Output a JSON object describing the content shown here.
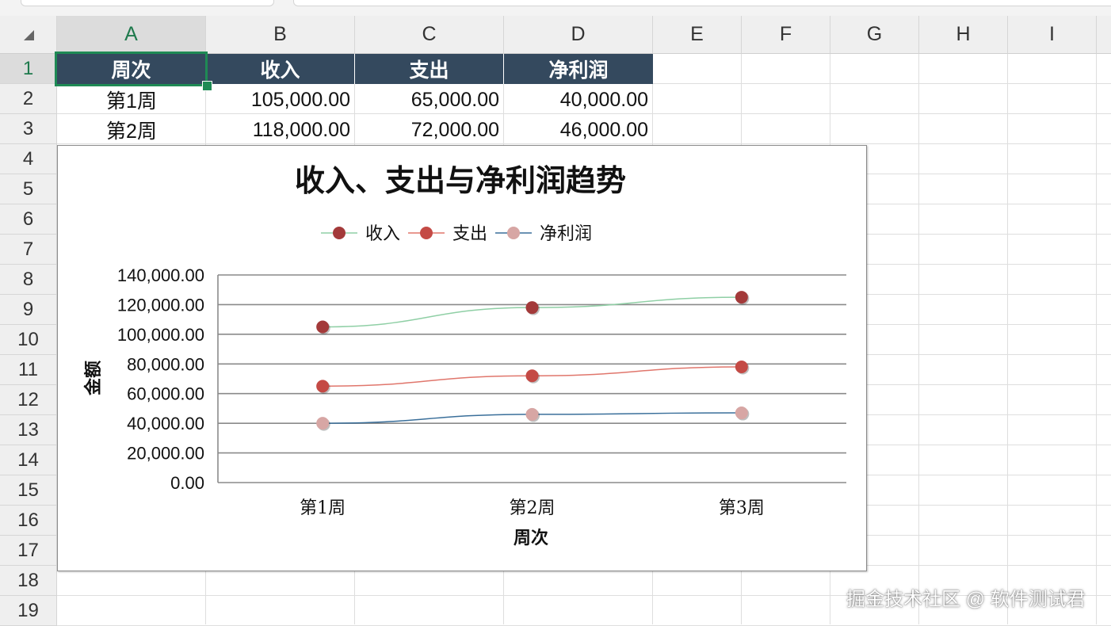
{
  "columns": [
    "A",
    "B",
    "C",
    "D",
    "E",
    "F",
    "G",
    "H",
    "I"
  ],
  "rows": [
    "1",
    "2",
    "3",
    "4",
    "5",
    "6",
    "7",
    "8",
    "9",
    "10",
    "11",
    "12",
    "13",
    "14",
    "15",
    "16",
    "17",
    "18",
    "19"
  ],
  "active_cell": "A1",
  "table": {
    "headers": [
      "周次",
      "收入",
      "支出",
      "净利润"
    ],
    "rows": [
      [
        "第1周",
        "105,000.00",
        "65,000.00",
        "40,000.00"
      ],
      [
        "第2周",
        "118,000.00",
        "72,000.00",
        "46,000.00"
      ]
    ]
  },
  "colors": {
    "header_fill": "#34495e",
    "selection": "#1f8a55",
    "series_income": "#a33a3a",
    "series_expense": "#c44a45",
    "series_profit": "#d7a6a4",
    "line_income": "#8fcfa5",
    "line_expense": "#e0766c",
    "line_profit": "#3a6f9a"
  },
  "chart_data": {
    "type": "line",
    "title": "收入、支出与净利润趋势",
    "xlabel": "周次",
    "ylabel": "金额",
    "categories": [
      "第1周",
      "第2周",
      "第3周"
    ],
    "ylim": [
      0,
      140000
    ],
    "yticks": [
      "0.00",
      "20,000.00",
      "40,000.00",
      "60,000.00",
      "80,000.00",
      "100,000.00",
      "120,000.00",
      "140,000.00"
    ],
    "legend_position": "top",
    "grid": true,
    "series": [
      {
        "name": "收入",
        "values": [
          105000,
          118000,
          125000
        ]
      },
      {
        "name": "支出",
        "values": [
          65000,
          72000,
          78000
        ]
      },
      {
        "name": "净利润",
        "values": [
          40000,
          46000,
          47000
        ]
      }
    ]
  },
  "watermark": "掘金技术社区 @ 软件测试君"
}
